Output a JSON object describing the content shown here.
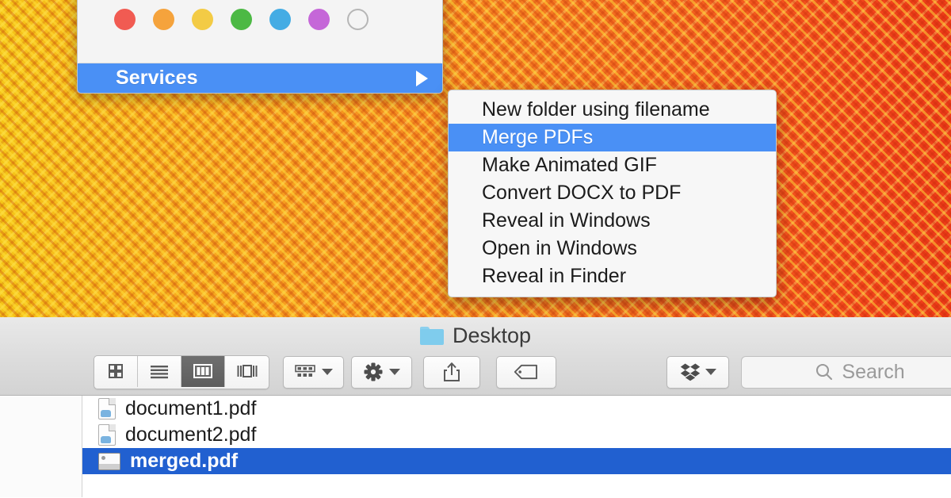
{
  "desktop": {
    "background_colors": {
      "left": "#f5c518",
      "middle": "#f57f20",
      "right": "#ee3b18"
    }
  },
  "context_menu": {
    "tag_colors": [
      {
        "name": "tag-red",
        "hex": "#f15b52"
      },
      {
        "name": "tag-orange",
        "hex": "#f5a33c"
      },
      {
        "name": "tag-yellow",
        "hex": "#f3cb45"
      },
      {
        "name": "tag-green",
        "hex": "#4cb944"
      },
      {
        "name": "tag-blue",
        "hex": "#44ace4"
      },
      {
        "name": "tag-purple",
        "hex": "#c567d8"
      },
      {
        "name": "tag-none",
        "hex": "#f4f4f4"
      }
    ],
    "services_label": "Services",
    "submenu_arrow_icon": "triangle-right-icon",
    "highlight_color": "#4a90f5"
  },
  "services_submenu": {
    "items": [
      {
        "label": "New folder using filename",
        "selected": false
      },
      {
        "label": "Merge PDFs",
        "selected": true
      },
      {
        "label": "Make Animated GIF",
        "selected": false
      },
      {
        "label": "Convert DOCX to PDF",
        "selected": false
      },
      {
        "label": "Reveal in Windows",
        "selected": false
      },
      {
        "label": "Open in Windows",
        "selected": false
      },
      {
        "label": "Reveal in Finder",
        "selected": false
      }
    ],
    "highlight_color": "#4a90f5"
  },
  "finder": {
    "title": "Desktop",
    "folder_icon": "folder-icon",
    "toolbar": {
      "view_modes": [
        {
          "name": "icon-view-button",
          "icon": "grid-icon",
          "active": false
        },
        {
          "name": "list-view-button",
          "icon": "list-icon",
          "active": false
        },
        {
          "name": "column-view-button",
          "icon": "columns-icon",
          "active": true
        },
        {
          "name": "gallery-view-button",
          "icon": "gallery-icon",
          "active": false
        }
      ],
      "arrange_button": {
        "icon": "arrange-grid-icon",
        "chevron": "chevron-down-icon"
      },
      "action_button": {
        "icon": "gear-icon",
        "chevron": "chevron-down-icon"
      },
      "share_button": {
        "icon": "share-icon"
      },
      "tag_button": {
        "icon": "tag-icon"
      },
      "dropbox_button": {
        "icon": "dropbox-icon",
        "chevron": "chevron-down-icon"
      },
      "search": {
        "icon": "search-icon",
        "placeholder": "Search",
        "value": ""
      }
    },
    "files": [
      {
        "name": "document1.pdf",
        "icon": "pdf-document-icon",
        "selected": false
      },
      {
        "name": "document2.pdf",
        "icon": "pdf-document-icon",
        "selected": false
      },
      {
        "name": "merged.pdf",
        "icon": "pdf-preview-icon",
        "selected": true
      }
    ],
    "selection_color": "#2160d0"
  }
}
